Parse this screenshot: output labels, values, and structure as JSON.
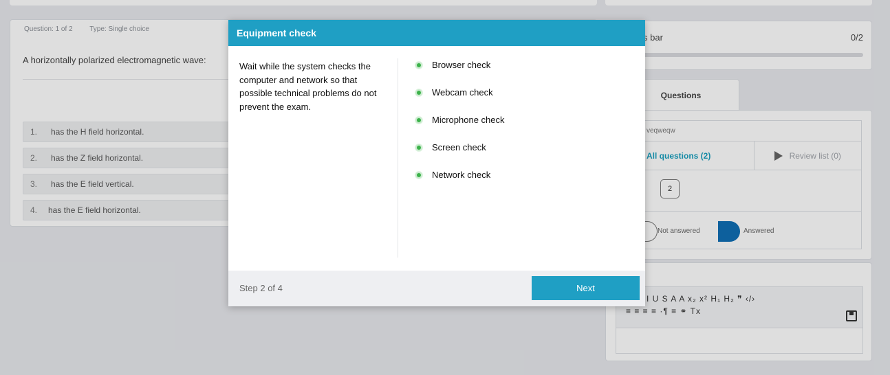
{
  "question": {
    "number_label": "Question: 1 of 2",
    "type_label": "Type: Single choice",
    "text": "A horizontally polarized electromagnetic wave:",
    "options": [
      {
        "num": "1.",
        "text": "has the H field horizontal."
      },
      {
        "num": "2.",
        "text": "has the Z field horizontal."
      },
      {
        "num": "3.",
        "text": "has the E field vertical."
      },
      {
        "num": "4.",
        "text": "has the E field horizontal."
      }
    ]
  },
  "progress": {
    "title": "s bar",
    "count": "0/2",
    "fraction": 0
  },
  "questions_tab": {
    "label": "Questions",
    "name_fragment": "veqweqw",
    "all_label": "All questions (2)",
    "review_label": "Review list (0)",
    "numbers": [
      "2"
    ],
    "legend_not_answered": "Not answered",
    "legend_answered": "Answered"
  },
  "notes": {
    "toolbar_row1": "I  U  S  A  A  x₂  x²  H₁  H₂  ❞  ‹/›",
    "toolbar_row2": "≡  ≡  ≡  ≡  ·¶  ≡  ⚭  Tx"
  },
  "modal": {
    "title": "Equipment check",
    "description": "Wait while the system checks the computer and network so that possible technical problems do not prevent the exam.",
    "checks": [
      "Browser check",
      "Webcam check",
      "Microphone check",
      "Screen check",
      "Network check"
    ],
    "step_label": "Step 2 of 4",
    "next_label": "Next"
  },
  "colors": {
    "accent": "#1f9fc4",
    "answered": "#0f6fb5",
    "check_ok": "#3cb24a"
  }
}
